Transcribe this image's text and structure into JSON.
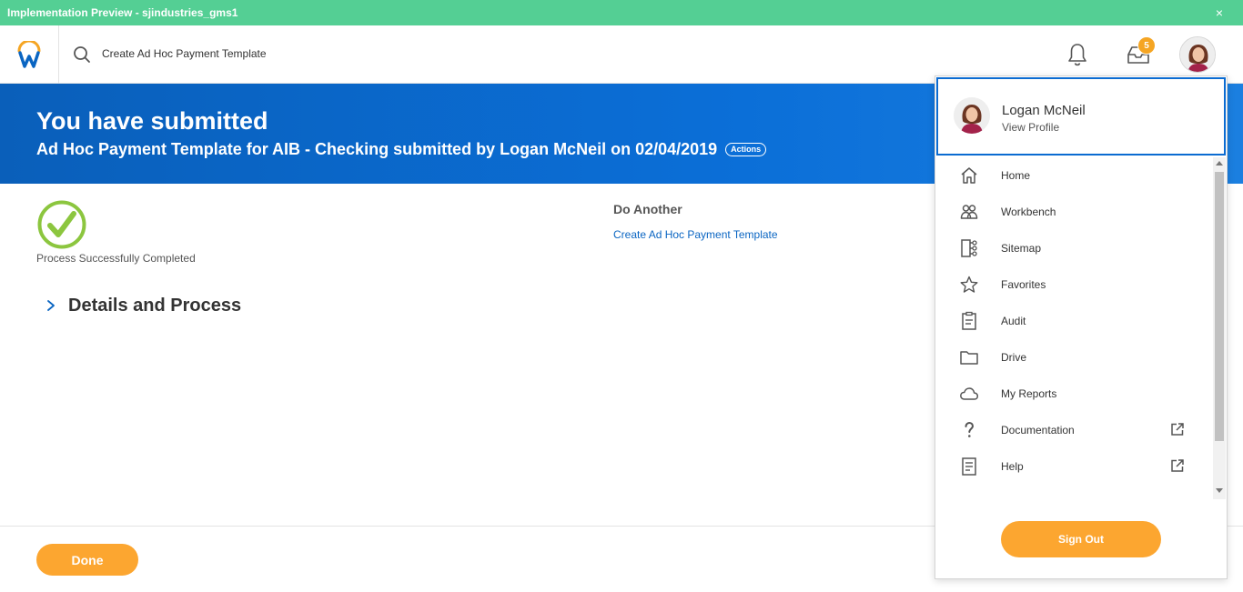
{
  "preview_bar": {
    "title": "Implementation Preview - sjindustries_gms1",
    "close_glyph": "×"
  },
  "header": {
    "search_text": "Create Ad Hoc Payment Template",
    "inbox_count": "5"
  },
  "banner": {
    "title": "You have submitted",
    "subtitle": "Ad Hoc Payment Template for AIB - Checking submitted by Logan McNeil on 02/04/2019",
    "actions_label": "Actions"
  },
  "status": {
    "label": "Process Successfully Completed"
  },
  "do_another": {
    "heading": "Do Another",
    "link": "Create Ad Hoc Payment Template"
  },
  "details": {
    "title": "Details and Process"
  },
  "footer": {
    "done_label": "Done"
  },
  "profile": {
    "name": "Logan McNeil",
    "view_profile": "View Profile"
  },
  "menu": {
    "items": [
      {
        "label": "Home",
        "icon": "home-icon"
      },
      {
        "label": "Workbench",
        "icon": "people-icon"
      },
      {
        "label": "Sitemap",
        "icon": "sitemap-icon"
      },
      {
        "label": "Favorites",
        "icon": "star-icon"
      },
      {
        "label": "Audit",
        "icon": "clipboard-icon"
      },
      {
        "label": "Drive",
        "icon": "folder-icon"
      },
      {
        "label": "My Reports",
        "icon": "cloud-icon"
      },
      {
        "label": "Documentation",
        "icon": "question-icon",
        "external": true
      },
      {
        "label": "Help",
        "icon": "document-icon",
        "external": true
      }
    ],
    "sign_out": "Sign Out"
  },
  "colors": {
    "preview_bar": "#54cf94",
    "banner": "#0b6fd8",
    "accent_orange": "#fca630",
    "success_green": "#8cc63f",
    "link_blue": "#0a65c2"
  }
}
